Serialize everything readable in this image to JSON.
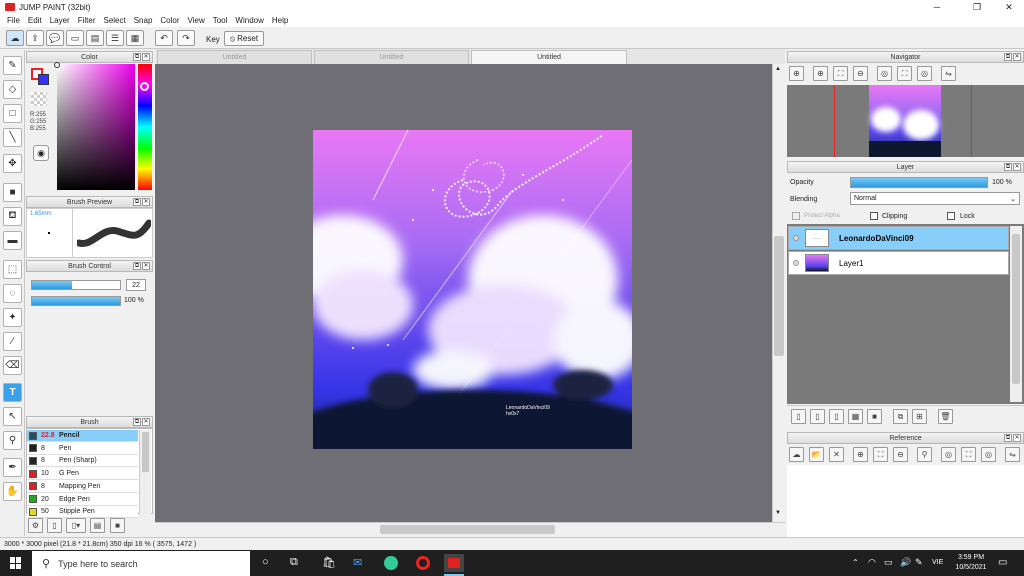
{
  "window": {
    "title": "JUMP PAINT (32bit)"
  },
  "menu": [
    "File",
    "Edit",
    "Layer",
    "Filter",
    "Select",
    "Snap",
    "Color",
    "View",
    "Tool",
    "Window",
    "Help"
  ],
  "toolbar": {
    "key_label": "Key",
    "reset_label": "Reset"
  },
  "tabs": [
    {
      "label": "Untitled"
    },
    {
      "label": "Untitled"
    },
    {
      "label": "Untitled"
    }
  ],
  "color_panel": {
    "title": "Color",
    "r": "R:255",
    "g": "G:255",
    "b": "B:255",
    "foreground": "#ffffff",
    "background": "#3333ff"
  },
  "brush_preview": {
    "title": "Brush Preview",
    "size": "1.65mm"
  },
  "brush_control": {
    "title": "Brush Control",
    "size_value": "22",
    "opacity_value": "100 %",
    "size_fill": 0.45,
    "opacity_fill": 1.0
  },
  "brush_panel": {
    "title": "Brush",
    "items": [
      {
        "size": "22.8",
        "name": "Pencil",
        "color": "#2a4a66",
        "selected": true
      },
      {
        "size": "8",
        "name": "Pen",
        "color": "#222222"
      },
      {
        "size": "8",
        "name": "Pen (Sharp)",
        "color": "#222222"
      },
      {
        "size": "10",
        "name": "G Pen",
        "color": "#dd2222"
      },
      {
        "size": "8",
        "name": "Mapping Pen",
        "color": "#dd2222"
      },
      {
        "size": "20",
        "name": "Edge Pen",
        "color": "#22aa22"
      },
      {
        "size": "50",
        "name": "Stipple Pen",
        "color": "#dddd22"
      }
    ]
  },
  "navigator": {
    "title": "Navigator"
  },
  "layer_panel": {
    "title": "Layer",
    "opacity_label": "Opacity",
    "opacity_value": "100 %",
    "opacity_fill": 1.0,
    "blending_label": "Blending",
    "blending_value": "Normal",
    "protect_alpha": "Protect Alpha",
    "clipping": "Clipping",
    "lock": "Lock",
    "layers": [
      {
        "name": "LeonardoDaVinci09",
        "selected": true
      },
      {
        "name": "Layer1",
        "selected": false
      }
    ]
  },
  "reference": {
    "title": "Reference"
  },
  "artwork": {
    "signature_line1": "LeonardoDaVinci09",
    "signature_line2": "hx0x7"
  },
  "status": {
    "text": "3000 * 3000 pixel  (21.8 * 21.8cm)  350 dpi  16 %  ( 3575, 1472 )"
  },
  "taskbar": {
    "search_placeholder": "Type here to search",
    "language": "VIE",
    "time": "3:59 PM",
    "date": "10/5/2021"
  }
}
